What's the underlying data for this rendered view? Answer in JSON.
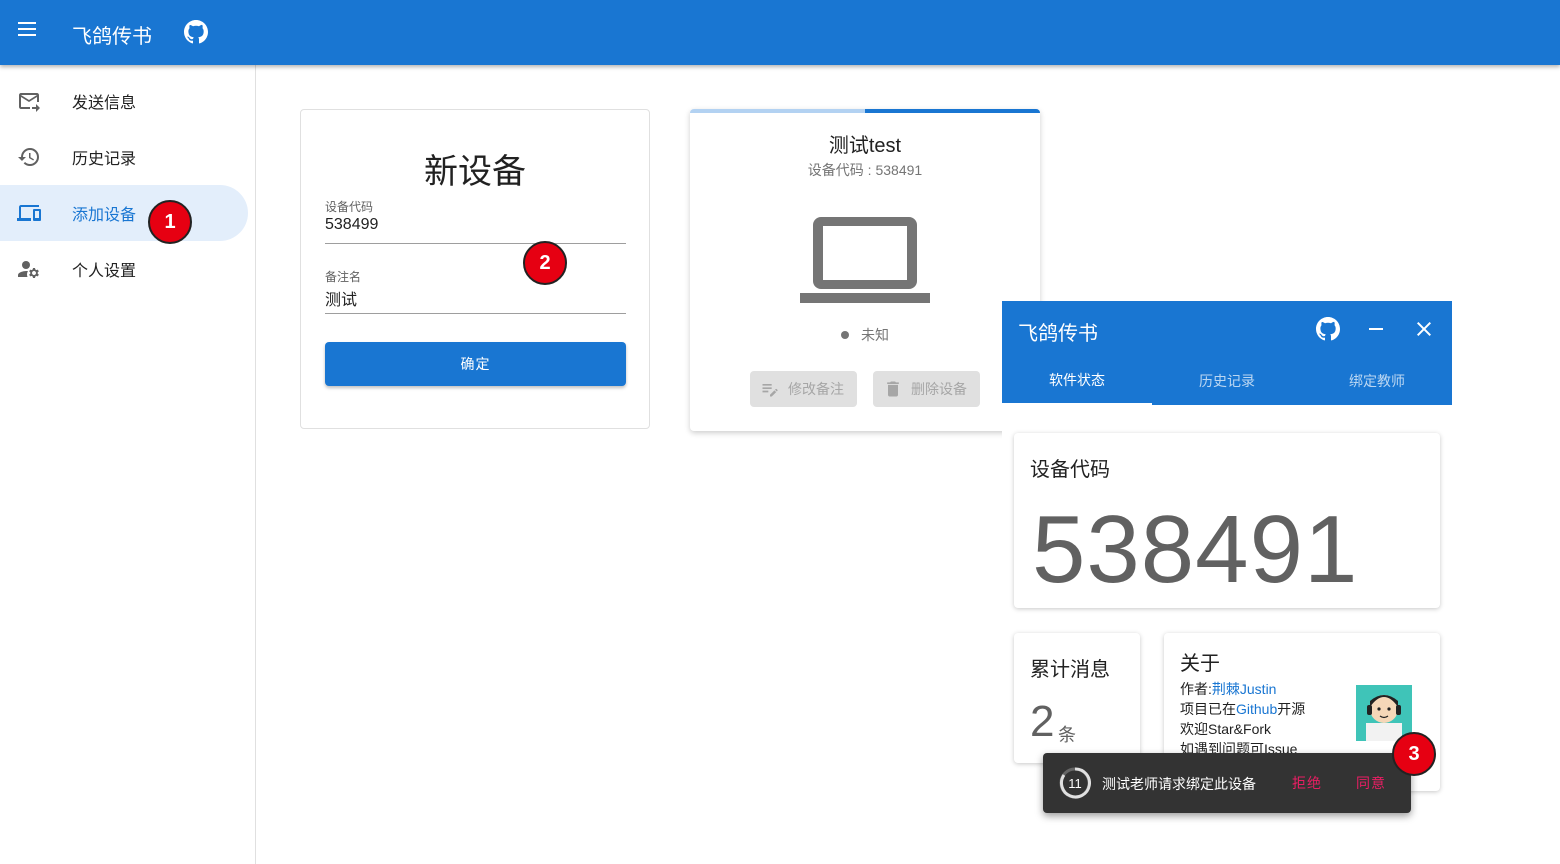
{
  "app": {
    "title": "飞鸽传书",
    "icons": {
      "menu": "menu-icon",
      "github": "github-icon"
    }
  },
  "sidebar": {
    "items": [
      {
        "label": "发送信息",
        "icon": "send-mail-icon",
        "active": false
      },
      {
        "label": "历史记录",
        "icon": "history-icon",
        "active": false
      },
      {
        "label": "添加设备",
        "icon": "devices-icon",
        "active": true
      },
      {
        "label": "个人设置",
        "icon": "account-settings-icon",
        "active": false
      }
    ]
  },
  "new_device": {
    "heading": "新设备",
    "code_label": "设备代码",
    "code_value": "538499",
    "remark_label": "备注名",
    "remark_value": "测试",
    "confirm_label": "确定"
  },
  "device_card": {
    "name": "测试test",
    "code_line": "设备代码 : 538491",
    "status": "未知",
    "edit_label": "修改备注",
    "delete_label": "删除设备",
    "progress": 0.5
  },
  "mini_window": {
    "title": "飞鸽传书",
    "tabs": [
      {
        "label": "软件状态",
        "active": true
      },
      {
        "label": "历史记录",
        "active": false
      },
      {
        "label": "绑定教师",
        "active": false
      }
    ],
    "code_card": {
      "title": "设备代码",
      "value": "538491"
    },
    "count_card": {
      "title": "累计消息",
      "value": "2",
      "unit": "条"
    },
    "about": {
      "title": "关于",
      "author_prefix": "作者:",
      "author_name": "荆棘Justin",
      "line2_prefix": "项目已在",
      "line2_link": "Github",
      "line2_suffix": "开源",
      "line3": "欢迎Star&Fork",
      "line4": "如遇到问题可Issue"
    }
  },
  "snackbar": {
    "countdown": "11",
    "message": "测试老师请求绑定此设备",
    "reject_label": "拒绝",
    "accept_label": "同意"
  },
  "markers": [
    "1",
    "2",
    "3"
  ],
  "colors": {
    "primary": "#1976d2",
    "snackbar_action": "#e91e63",
    "marker": "#e60012"
  }
}
